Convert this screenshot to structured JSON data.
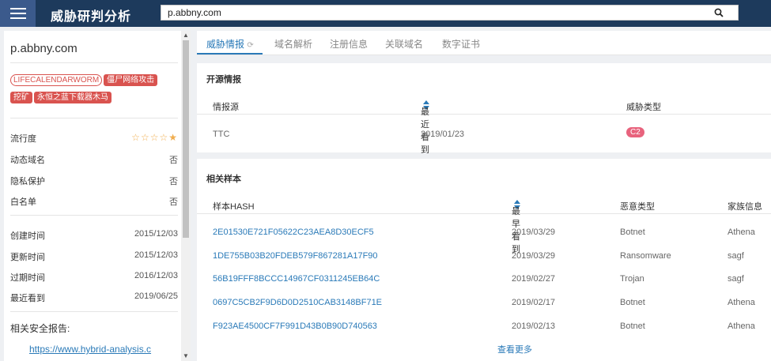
{
  "header": {
    "app_title": "威胁研判分析",
    "search_value": "p.abbny.com"
  },
  "left": {
    "domain": "p.abbny.com",
    "tags": [
      "LIFECALENDARWORM",
      "僵尸网络攻击",
      "挖矿",
      "永恒之蓝下载器木马"
    ],
    "attrs": [
      {
        "label": "流行度",
        "value": ""
      },
      {
        "label": "动态域名",
        "value": "否"
      },
      {
        "label": "隐私保护",
        "value": "否"
      },
      {
        "label": "白名单",
        "value": "否"
      }
    ],
    "popularity_stars": 1,
    "popularity_max": 5,
    "dates": [
      {
        "label": "创建时间",
        "value": "2015/12/03"
      },
      {
        "label": "更新时间",
        "value": "2015/12/03"
      },
      {
        "label": "过期时间",
        "value": "2016/12/03"
      },
      {
        "label": "最近看到",
        "value": "2019/06/25"
      }
    ],
    "reports_title": "相关安全报告:",
    "report_link": "https://www.hybrid-analysis.c"
  },
  "tabs": [
    "威胁情报",
    "域名解析",
    "注册信息",
    "关联域名",
    "数字证书"
  ],
  "open_intel": {
    "title": "开源情报",
    "columns": [
      "情报源",
      "最近看到",
      "威胁类型"
    ],
    "rows": [
      {
        "source": "TTC",
        "last_seen": "2019/01/23",
        "threat": "C2"
      }
    ]
  },
  "samples": {
    "title": "相关样本",
    "columns": [
      "样本HASH",
      "最早看到",
      "恶意类型",
      "家族信息"
    ],
    "rows": [
      {
        "hash": "2E01530E721F05622C23AEA8D30ECF5",
        "first_seen": "2019/03/29",
        "type": "Botnet",
        "family": "Athena"
      },
      {
        "hash": "1DE755B03B20FDEB579F867281A17F90",
        "first_seen": "2019/03/29",
        "type": "Ransomware",
        "family": "sagf"
      },
      {
        "hash": "56B19FFF8BCCC14967CF0311245EB64C",
        "first_seen": "2019/02/27",
        "type": "Trojan",
        "family": "sagf"
      },
      {
        "hash": "0697C5CB2F9D6D0D2510CAB3148BF71E",
        "first_seen": "2019/02/17",
        "type": "Botnet",
        "family": "Athena"
      },
      {
        "hash": "F923AE4500CF7F991D43B0B90D740563",
        "first_seen": "2019/02/13",
        "type": "Botnet",
        "family": "Athena"
      }
    ],
    "more_label": "查看更多"
  },
  "colors": {
    "topbar": "#1d3a5c",
    "accent": "#2a7ab8",
    "tag_red": "#d9534f",
    "badge_pink": "#e8637d",
    "star": "#f0ad4e"
  }
}
